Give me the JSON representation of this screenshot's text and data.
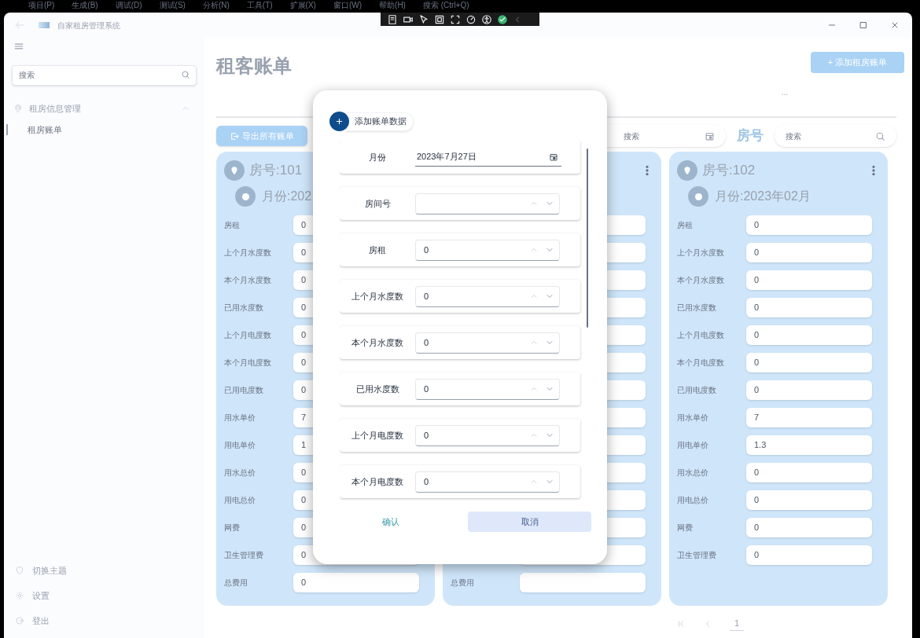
{
  "ide_menu": [
    "项目(P)",
    "生成(B)",
    "调试(D)",
    "测试(S)",
    "分析(N)",
    "工具(T)",
    "扩展(X)",
    "窗口(W)",
    "帮助(H)",
    "搜索 (Ctrl+Q)"
  ],
  "window": {
    "title": "自家租房管理系统"
  },
  "sidebar": {
    "search": {
      "placeholder": "搜索"
    },
    "items": [
      {
        "label": "租房信息管理",
        "expanded": true,
        "children": [
          {
            "label": "租房账单",
            "selected": true
          }
        ]
      }
    ],
    "footer": [
      "切换主题",
      "设置",
      "登出"
    ]
  },
  "page": {
    "title": "租客账单",
    "add_button": "+ 添加租房账单",
    "tab_more": "...",
    "export_button": "导出所有账单",
    "date_search": {
      "placeholder": "搜索"
    },
    "room_label": "房号",
    "room_search": {
      "placeholder": "搜索"
    }
  },
  "cards": [
    {
      "room": "房号:101",
      "month": "月份:202",
      "rows": [
        {
          "kind": "field",
          "label": "房租",
          "value": "0"
        },
        {
          "kind": "field",
          "label": "上个月水度数",
          "value": "0"
        },
        {
          "kind": "field",
          "label": "本个月水度数",
          "value": "0"
        },
        {
          "kind": "field",
          "label": "已用水度数",
          "value": "0"
        },
        {
          "kind": "field",
          "label": "上个月电度数",
          "value": "0"
        },
        {
          "kind": "field",
          "label": "本个月电度数",
          "value": "0"
        },
        {
          "kind": "field",
          "label": "已用电度数",
          "value": "0"
        },
        {
          "kind": "field",
          "label": "用水单价",
          "value": "7"
        },
        {
          "kind": "field",
          "label": "用电单价",
          "value": "1"
        },
        {
          "kind": "field",
          "label": "用水总价",
          "value": "0"
        },
        {
          "kind": "field",
          "label": "用电总价",
          "value": "0"
        },
        {
          "kind": "field",
          "label": "网费",
          "value": "0"
        },
        {
          "kind": "field",
          "label": "卫生管理费",
          "value": "0"
        },
        {
          "kind": "field",
          "label": "总费用",
          "value": "0"
        }
      ]
    },
    {
      "menu": true,
      "rows": [
        {
          "kind": "blank"
        },
        {
          "kind": "blank"
        },
        {
          "kind": "blank"
        },
        {
          "kind": "blank"
        },
        {
          "kind": "blank"
        },
        {
          "kind": "blank"
        },
        {
          "kind": "blank"
        },
        {
          "kind": "blank"
        },
        {
          "kind": "blank"
        },
        {
          "kind": "blank"
        },
        {
          "kind": "blank"
        },
        {
          "kind": "blank"
        },
        {
          "kind": "blank"
        },
        {
          "kind": "label",
          "label": "总费用"
        }
      ]
    },
    {
      "room": "房号:102",
      "menu": true,
      "month": "月份:2023年02月",
      "rows": [
        {
          "kind": "field",
          "label": "房租",
          "value": "0"
        },
        {
          "kind": "field",
          "label": "上个月水度数",
          "value": "0"
        },
        {
          "kind": "field",
          "label": "本个月水度数",
          "value": "0"
        },
        {
          "kind": "field",
          "label": "已用水度数",
          "value": "0"
        },
        {
          "kind": "field",
          "label": "上个月电度数",
          "value": "0"
        },
        {
          "kind": "field",
          "label": "本个月电度数",
          "value": "0"
        },
        {
          "kind": "field",
          "label": "已用电度数",
          "value": "0"
        },
        {
          "kind": "field",
          "label": "用水单价",
          "value": "7"
        },
        {
          "kind": "field",
          "label": "用电单价",
          "value": "1.3"
        },
        {
          "kind": "field",
          "label": "用水总价",
          "value": "0"
        },
        {
          "kind": "field",
          "label": "用电总价",
          "value": "0"
        },
        {
          "kind": "field",
          "label": "网费",
          "value": "0"
        },
        {
          "kind": "field",
          "label": "卫生管理费",
          "value": "0"
        }
      ]
    }
  ],
  "pagination": {
    "current": "1"
  },
  "dialog": {
    "title": "添加账单数据",
    "fields": [
      {
        "kind": "date",
        "label": "月份",
        "value": "2023年7月27日"
      },
      {
        "kind": "number",
        "label": "房间号"
      },
      {
        "kind": "number",
        "label": "房租",
        "value": "0"
      },
      {
        "kind": "number",
        "label": "上个月水度数",
        "value": "0"
      },
      {
        "kind": "number",
        "label": "本个月水度数",
        "value": "0"
      },
      {
        "kind": "number",
        "label": "已用水度数",
        "value": "0"
      },
      {
        "kind": "number",
        "label": "上个月电度数",
        "value": "0"
      },
      {
        "kind": "number",
        "label": "本个月电度数",
        "value": "0"
      }
    ],
    "confirm": "确认",
    "cancel": "取消"
  }
}
